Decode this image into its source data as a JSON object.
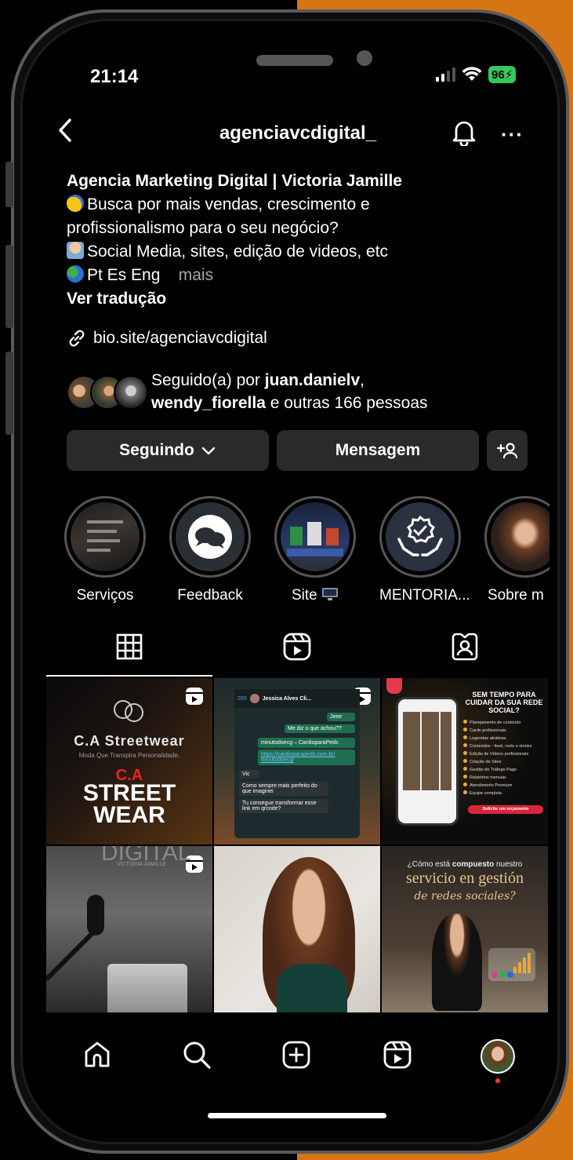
{
  "status": {
    "time": "21:14",
    "battery": "96"
  },
  "header": {
    "username": "agenciavcdigital_"
  },
  "bio": {
    "name": "Agencia Marketing Digital | Victoria Jamille",
    "line1": "Busca por mais vendas, crescimento e",
    "line2": "profissionalismo para o seu negócio?",
    "line3": "Social Media, sites, edição de videos, etc",
    "line4": "Pt Es Eng",
    "more": "mais",
    "translate": "Ver tradução"
  },
  "link": "bio.site/agenciavcdigital",
  "followed_by": {
    "prefix": "Seguido(a) por ",
    "user1": "juan.danielv",
    "comma": ",",
    "user2": "wendy_fiorella",
    "suffix": " e outras 166 pessoas"
  },
  "buttons": {
    "following": "Seguindo",
    "message": "Mensagem"
  },
  "highlights": [
    {
      "label": "Serviços"
    },
    {
      "label": "Feedback"
    },
    {
      "label": "Site"
    },
    {
      "label": "MENTORIA..."
    },
    {
      "label": "Sobre m"
    }
  ],
  "posts": {
    "p1_brand": "C.A Streetwear",
    "p1_sub": "Moda Que Transpira Personalidade.",
    "p1_logo_top": "C.A",
    "p1_logo_mid": "STREET",
    "p1_logo_bot": "WEAR",
    "p2_header": "Jessica Alves Cli...",
    "p2_back": "265",
    "p2_msg1": "Jeee",
    "p2_msg2": "Me diz o que achou??",
    "p2_msg3": "minutodoecg – CardioparaPeds",
    "p2_msg4": "https://cardioparapeds.com.br/ minutodoecg/",
    "p2_msg5": "Vic",
    "p2_msg6": "Como sempre mais perfeito do que imaginei",
    "p2_msg7": "Tu consegue transformar esse link em qrcode?",
    "p3_title": "SEM TEMPO PARA CUIDAR DA SUA REDE SOCIAL?",
    "p3_items": [
      "Planejamento de conteúdo",
      "Cards profissionais",
      "Legendas atrativas",
      "Conteúdos - feed, reels e stories",
      "Edição de Vídeos profissionais",
      "Criação de Sites",
      "Gestão de Tráfego Pago",
      "Relatórios mensais",
      "Atendimento Premium",
      "Equipe completa"
    ],
    "p3_cta": "Solicite um orçamento",
    "p4_watermark": "DIGITAL",
    "p4_watermark_sub": "VICTORIA JAMILLE",
    "p6_q1": "¿Cómo está ",
    "p6_q2": "compuesto",
    "p6_q3": " nuestro",
    "p6_big": "servicio en gestión",
    "p6_script": "de redes sociales?"
  }
}
